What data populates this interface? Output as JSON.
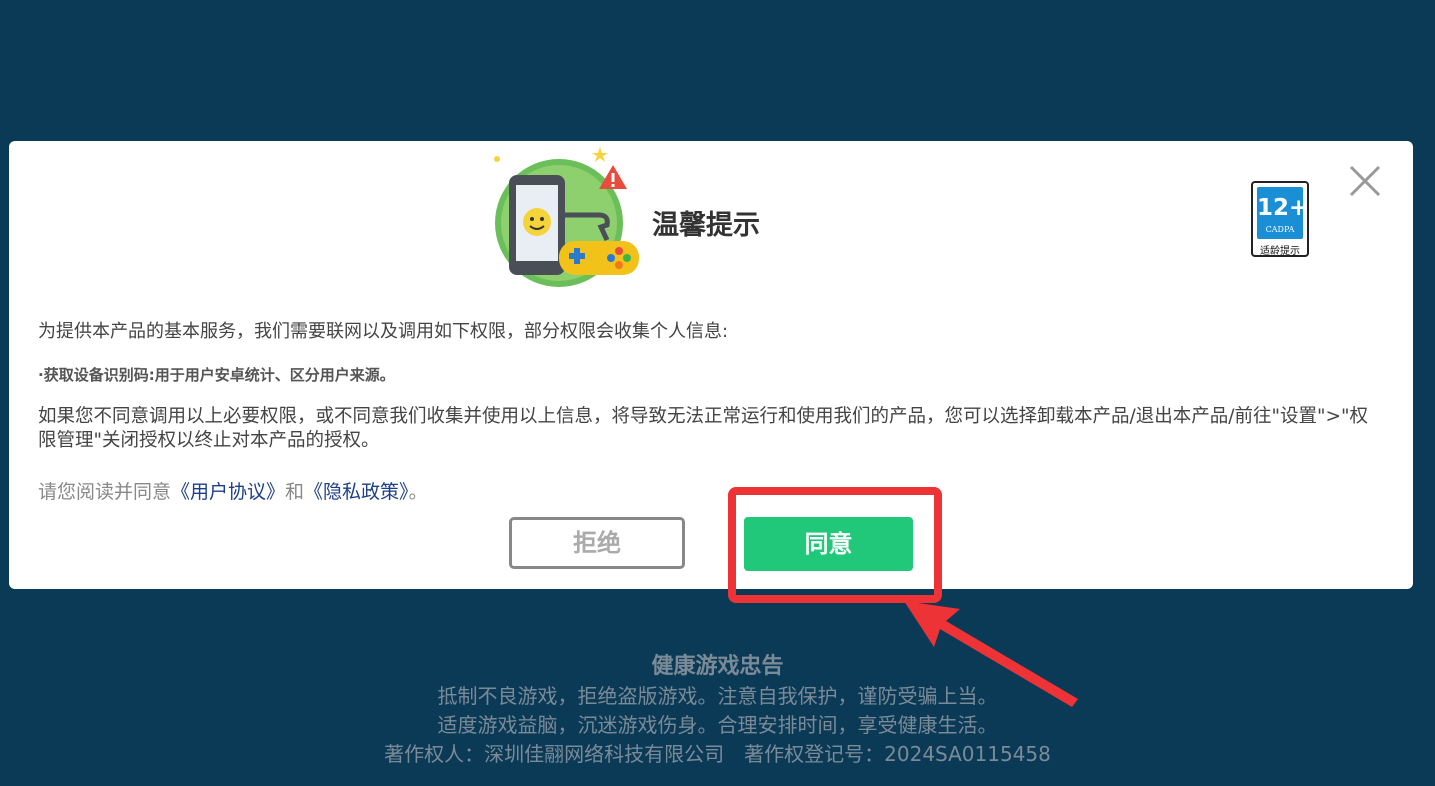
{
  "dialog": {
    "title": "温馨提示",
    "age_rating": {
      "number": "12+",
      "org": "CADPA",
      "tip": "适龄提示"
    },
    "intro": "为提供本产品的基本服务，我们需要联网以及调用如下权限，部分权限会收集个人信息:",
    "permission_item": "·获取设备识别码:用于用户安卓统计、区分用户来源。",
    "notice": "如果您不同意调用以上必要权限，或不同意我们收集并使用以上信息，将导致无法正常运行和使用我们的产品，您可以选择卸载本产品/退出本产品/前往\"设置\">\"权限管理\"关闭授权以终止对本产品的授权。",
    "agreement_prefix": "请您阅读并同意",
    "user_agreement_link": "《用户协议》",
    "and_text": "和",
    "privacy_policy_link": "《隐私政策》",
    "agreement_suffix": "。",
    "reject_label": "拒绝",
    "agree_label": "同意"
  },
  "footer": {
    "title": "健康游戏忠告",
    "line1": "抵制不良游戏，拒绝盗版游戏。注意自我保护，谨防受骗上当。",
    "line2": "适度游戏益脑，沉迷游戏伤身。合理安排时间，享受健康生活。",
    "line3": "著作权人：深圳佳翮网络科技有限公司　著作权登记号：2024SA0115458"
  },
  "colors": {
    "background": "#0b3a57",
    "agree_button": "#21c87a",
    "highlight": "#ee3337",
    "link": "#1d3f8a"
  }
}
